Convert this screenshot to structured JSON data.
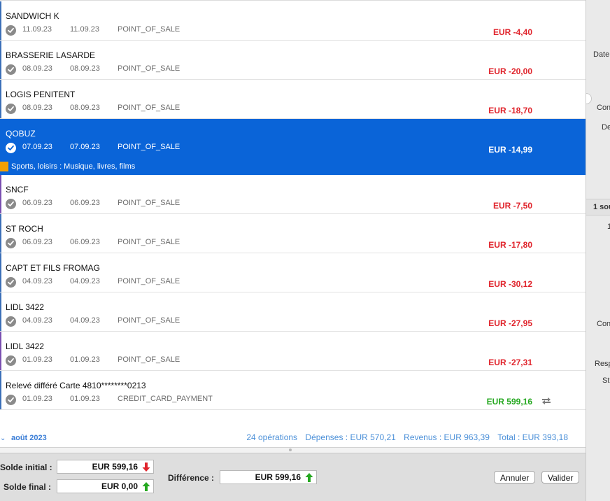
{
  "transactions": [
    {
      "name": "SANDWICH K",
      "date1": "11.09.23",
      "date2": "11.09.23",
      "type": "POINT_OF_SALE",
      "amount": "EUR -4,40",
      "positive": false
    },
    {
      "name": "BRASSERIE LASARDE",
      "date1": "08.09.23",
      "date2": "08.09.23",
      "type": "POINT_OF_SALE",
      "amount": "EUR -20,00",
      "positive": false
    },
    {
      "name": "LOGIS PENITENT",
      "date1": "08.09.23",
      "date2": "08.09.23",
      "type": "POINT_OF_SALE",
      "amount": "EUR -18,70",
      "positive": false
    },
    {
      "name": "QOBUZ",
      "date1": "07.09.23",
      "date2": "07.09.23",
      "type": "POINT_OF_SALE",
      "amount": "EUR -14,99",
      "positive": false,
      "selected": true,
      "category": "Sports, loisirs : Musique, livres, films"
    },
    {
      "name": "SNCF",
      "date1": "06.09.23",
      "date2": "06.09.23",
      "type": "POINT_OF_SALE",
      "amount": "EUR -7,50",
      "positive": false
    },
    {
      "name": "ST ROCH",
      "date1": "06.09.23",
      "date2": "06.09.23",
      "type": "POINT_OF_SALE",
      "amount": "EUR -17,80",
      "positive": false
    },
    {
      "name": "CAPT ET FILS FROMAG",
      "date1": "04.09.23",
      "date2": "04.09.23",
      "type": "POINT_OF_SALE",
      "amount": "EUR -30,12",
      "positive": false
    },
    {
      "name": "LIDL 3422",
      "date1": "04.09.23",
      "date2": "04.09.23",
      "type": "POINT_OF_SALE",
      "amount": "EUR -27,95",
      "positive": false
    },
    {
      "name": "LIDL 3422",
      "date1": "01.09.23",
      "date2": "01.09.23",
      "type": "POINT_OF_SALE",
      "amount": "EUR -27,31",
      "positive": false
    },
    {
      "name": "Relevé différé Carte 4810********0213",
      "date1": "01.09.23",
      "date2": "01.09.23",
      "type": "CREDIT_CARD_PAYMENT",
      "amount": "EUR 599,16",
      "positive": true,
      "transfer_icon": "transfer-arrows-icon"
    }
  ],
  "summary": {
    "month": "août 2023",
    "operations": "24 opérations",
    "expenses": "Dépenses : EUR 570,21",
    "income": "Revenus : EUR 963,39",
    "total": "Total : EUR 393,18"
  },
  "reconcile": {
    "initial_label": "Solde initial :",
    "initial_value": "EUR 599,16",
    "initial_arrow": "arrow-down-red-icon",
    "final_label": "Solde final :",
    "final_value": "EUR 0,00",
    "final_arrow": "arrow-up-green-icon",
    "difference_label": "Différence :",
    "difference_value": "EUR 599,16",
    "difference_arrow": "arrow-up-green-icon",
    "cancel_label": "Annuler",
    "validate_label": "Valider"
  },
  "side_panel": {
    "labels": [
      "Date",
      "Con",
      "De",
      "1 sou",
      "1",
      "Con",
      "Resp",
      "St"
    ]
  },
  "colors": {
    "selection": "#0a64d8",
    "negative": "#e0232b",
    "positive": "#25a820",
    "link": "#3a7dd6",
    "category": "#f5a000"
  }
}
